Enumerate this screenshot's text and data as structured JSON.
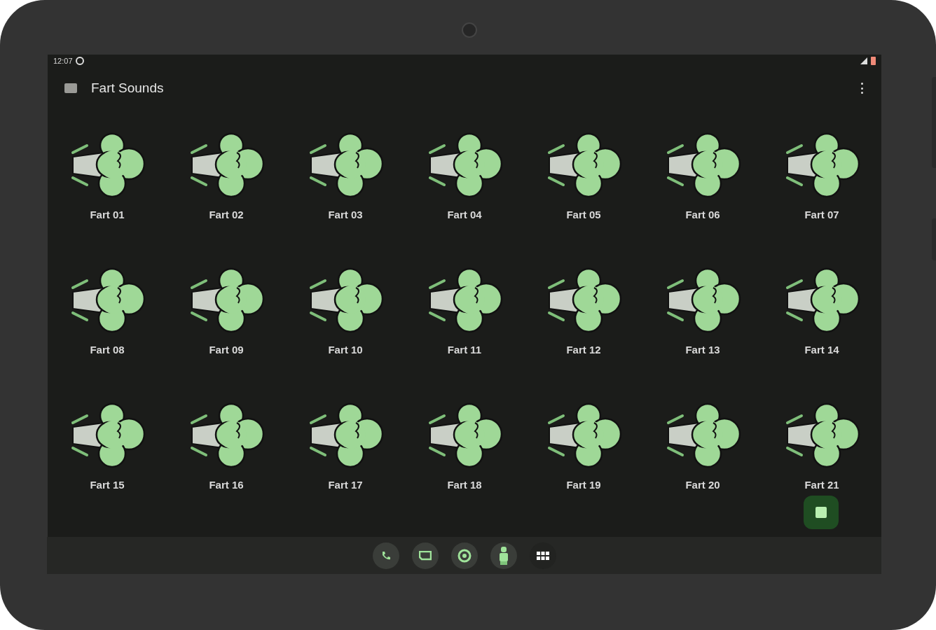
{
  "status_bar": {
    "time": "12:07"
  },
  "toolbar": {
    "title": "Fart Sounds"
  },
  "sounds": [
    {
      "label": "Fart 01"
    },
    {
      "label": "Fart 02"
    },
    {
      "label": "Fart 03"
    },
    {
      "label": "Fart 04"
    },
    {
      "label": "Fart 05"
    },
    {
      "label": "Fart 06"
    },
    {
      "label": "Fart 07"
    },
    {
      "label": "Fart 08"
    },
    {
      "label": "Fart 09"
    },
    {
      "label": "Fart 10"
    },
    {
      "label": "Fart 11"
    },
    {
      "label": "Fart 12"
    },
    {
      "label": "Fart 13"
    },
    {
      "label": "Fart 14"
    },
    {
      "label": "Fart 15"
    },
    {
      "label": "Fart 16"
    },
    {
      "label": "Fart 17"
    },
    {
      "label": "Fart 18"
    },
    {
      "label": "Fart 19"
    },
    {
      "label": "Fart 20"
    },
    {
      "label": "Fart 21"
    }
  ]
}
